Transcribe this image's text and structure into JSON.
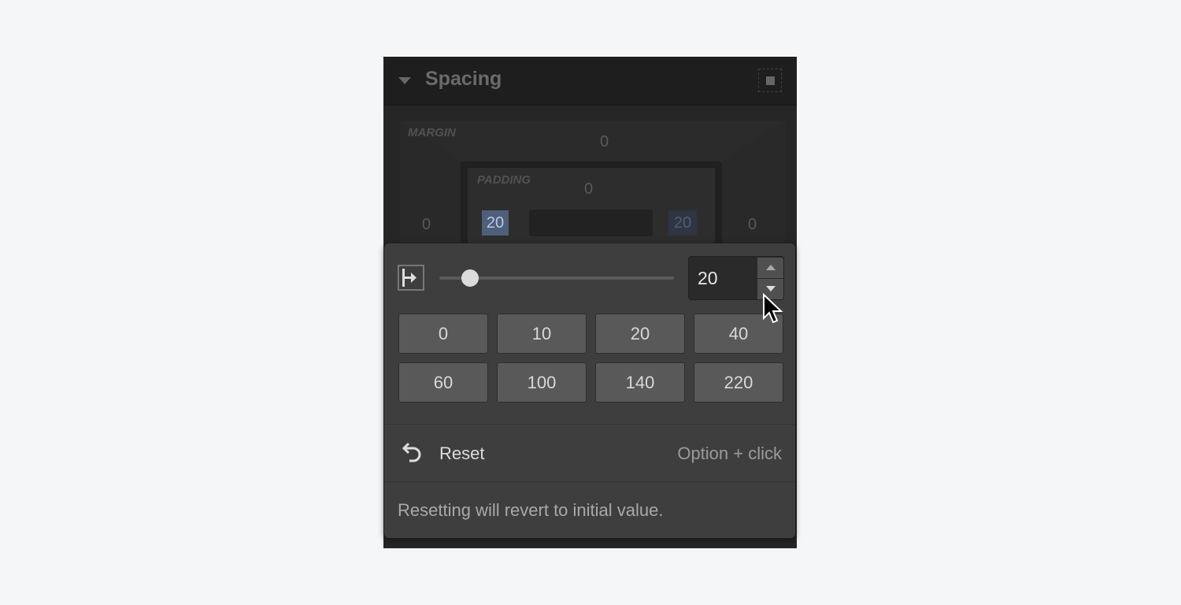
{
  "section": {
    "title": "Spacing",
    "collapse_icon": "caret-down-icon",
    "mode_icon": "box-spacing-icon"
  },
  "box_model": {
    "margin_label": "MARGIN",
    "margin": {
      "top": "0",
      "left": "0",
      "right": "0"
    },
    "padding_label": "PADDING",
    "padding": {
      "top": "0",
      "left": "20",
      "right": "20"
    }
  },
  "popup": {
    "side_icon": "padding-left-icon",
    "slider_value": 20,
    "input_value": "20",
    "presets": [
      "0",
      "10",
      "20",
      "40",
      "60",
      "100",
      "140",
      "220"
    ],
    "reset_label": "Reset",
    "reset_icon": "undo-icon",
    "reset_shortcut": "Option + click",
    "hint": "Resetting will revert to initial value."
  },
  "colors": {
    "selected_value_bg": "#4e5f7a",
    "popup_bg": "#3e3e3e",
    "page_bg": "#f5f6f8"
  }
}
